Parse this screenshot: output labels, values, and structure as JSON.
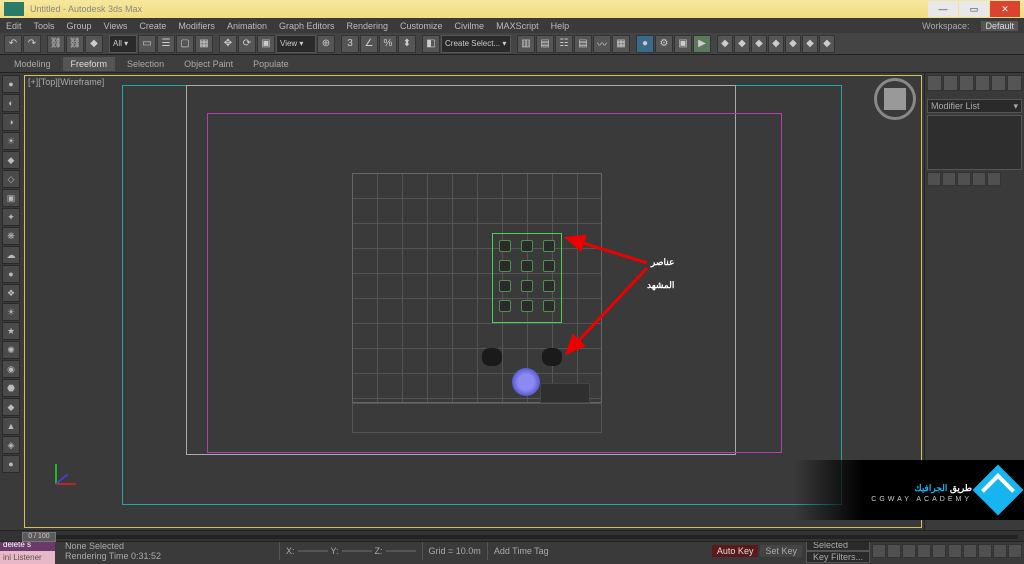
{
  "title_faint": "Untitled - Autodesk 3ds Max",
  "menus": [
    "Edit",
    "Tools",
    "Group",
    "Views",
    "Create",
    "Modifiers",
    "Animation",
    "Graph Editors",
    "Rendering",
    "Customize",
    "Civilme",
    "MAXScript",
    "Help"
  ],
  "workspace": {
    "label": "Workspace:",
    "value": "Default"
  },
  "ribbon_tabs": [
    "Modeling",
    "Freeform",
    "Selection",
    "Object Paint",
    "Populate"
  ],
  "ribbon_active": 1,
  "viewport_label": "[+][Top][Wireframe]",
  "modifier_list_label": "Modifier List",
  "annotation": {
    "line1": "عناصر",
    "line2": "المشهد"
  },
  "timeline": {
    "frame_label": "0 / 100",
    "rendering_time": "Rendering Time 0:31:52"
  },
  "status": {
    "delete": "delete s",
    "listener": "ini Listener",
    "none_selected": "None Selected",
    "x": "X:",
    "y": "Y:",
    "z": "Z:",
    "grid": "Grid = 10.0m",
    "addtag": "Add Time Tag",
    "autokey": "Auto Key",
    "setkey": "Set Key",
    "selected": "Selected",
    "keyfilters": "Key Filters..."
  },
  "watermark": {
    "ar_pre": "طريق ",
    "ar_hl": "الجرافيك",
    "en": "CGWAY ACADEMY"
  },
  "windowbuttons": {
    "min": "—",
    "max": "▭",
    "close": "✕"
  }
}
